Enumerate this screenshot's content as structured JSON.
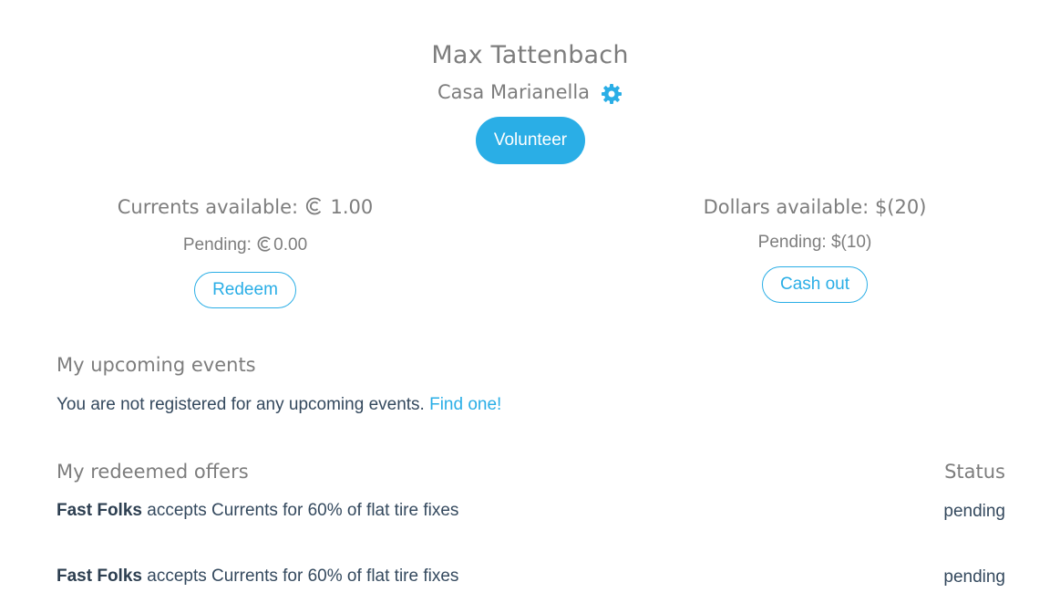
{
  "profile": {
    "name": "Max Tattenbach",
    "organization": "Casa Marianella",
    "settings_icon": "gear-icon",
    "volunteer_label": "Volunteer"
  },
  "currents": {
    "available_label": "Currents available:",
    "available_value": "1.00",
    "pending_label": "Pending:",
    "pending_value": "0.00",
    "icon": "currents-icon",
    "button_label": "Redeem"
  },
  "dollars": {
    "available_label": "Dollars available:",
    "available_value": "$(20)",
    "pending_label": "Pending:",
    "pending_value": "$(10)",
    "button_label": "Cash out"
  },
  "events": {
    "title": "My upcoming events",
    "empty_text": "You are not registered for any upcoming events.",
    "find_link": "Find one!"
  },
  "offers": {
    "title": "My redeemed offers",
    "status_header": "Status",
    "items": [
      {
        "business": "Fast Folks",
        "description": "accepts Currents for 60% of flat tire fixes",
        "status": "pending"
      },
      {
        "business": "Fast Folks",
        "description": "accepts Currents for 60% of flat tire fixes",
        "status": "pending"
      }
    ]
  },
  "colors": {
    "accent": "#2aaee6",
    "heading_text": "#7d7d7d",
    "body_text": "#34495e"
  }
}
